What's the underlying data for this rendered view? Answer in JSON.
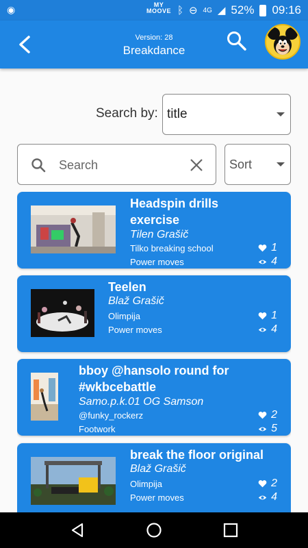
{
  "status_bar": {
    "brand_top": "MY",
    "brand_bottom": "MOOVE",
    "network": "4G",
    "battery": "52%",
    "time": "09:16"
  },
  "header": {
    "version": "Version: 28",
    "title": "Breakdance"
  },
  "filters": {
    "search_by_label": "Search by:",
    "search_by_value": "title",
    "search_placeholder": "Search",
    "sort_placeholder": "Sort"
  },
  "videos": [
    {
      "title_line1": "Headspin drills",
      "title_line2": "exercise",
      "author": "Tilen Grašič",
      "school": "Tilko breaking school",
      "category": "Power moves",
      "likes": "1",
      "views": "4"
    },
    {
      "title_line1": "Teelen",
      "title_line2": "",
      "author": "Blaž Grašič",
      "school": "Olimpija",
      "category": "Power moves",
      "likes": "1",
      "views": "4"
    },
    {
      "title_line1": "bboy @hansolo round for",
      "title_line2": "#wkbcebattle",
      "author": "Samo.p.k.01 OG Samson",
      "school": "@funky_rockerz",
      "category": "Footwork",
      "likes": "2",
      "views": "5"
    },
    {
      "title_line1": "break the floor original",
      "title_line2": "",
      "author": "Blaž Grašič",
      "school": "Olimpija",
      "category": "Power moves",
      "likes": "2",
      "views": "4"
    }
  ],
  "colors": {
    "primary": "#1f86e3",
    "status": "#1f7fd9"
  }
}
